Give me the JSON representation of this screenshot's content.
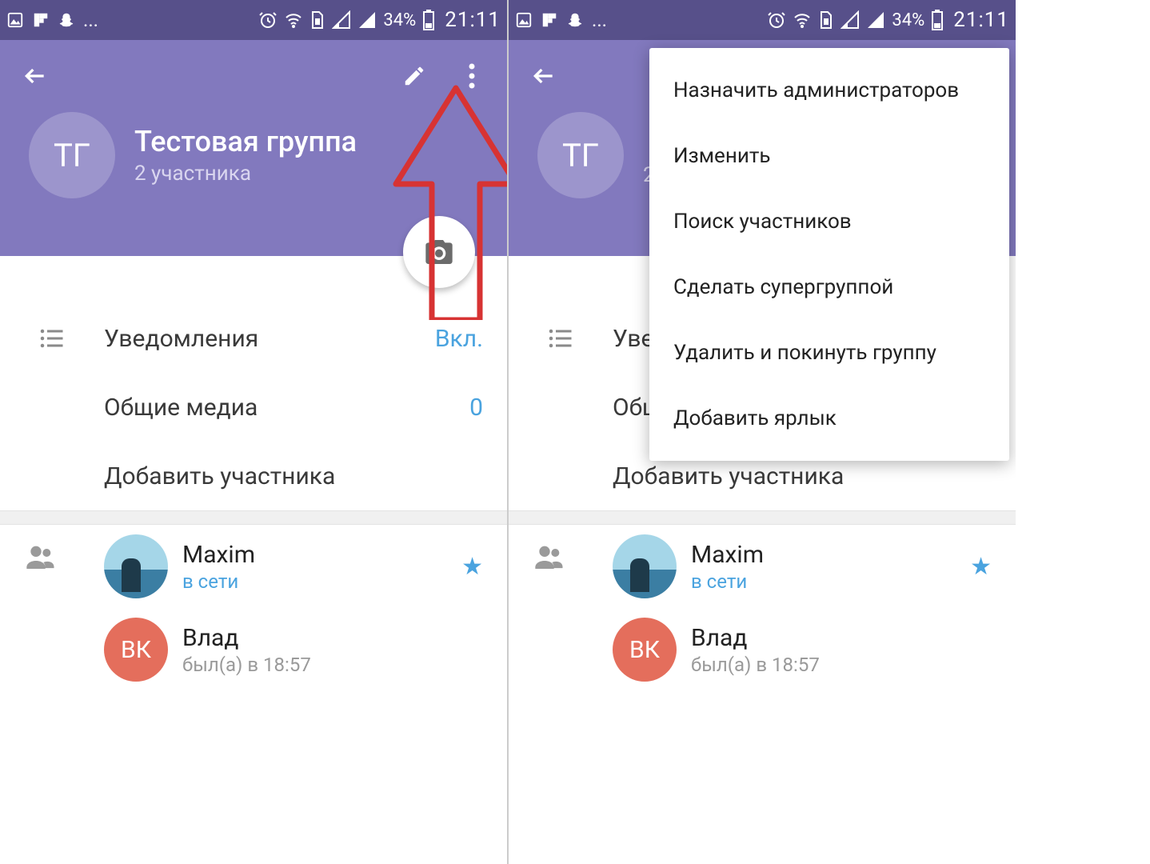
{
  "status": {
    "battery": "34%",
    "time": "21:11",
    "ellipsis": "..."
  },
  "header": {
    "avatar_initials": "ТГ",
    "title": "Тестовая группа",
    "subtitle": "2 участника"
  },
  "settings": {
    "notifications_label": "Уведомления",
    "notifications_value": "Вкл.",
    "shared_media_label": "Общие медиа",
    "shared_media_value": "0",
    "add_member_label": "Добавить участника"
  },
  "members": [
    {
      "name": "Maxim",
      "status": "в сети",
      "status_type": "online",
      "avatar_type": "photo",
      "initials": "",
      "starred": true
    },
    {
      "name": "Влад",
      "status": "был(а) в 18:57",
      "status_type": "offline",
      "avatar_type": "initials",
      "initials": "ВК",
      "starred": false
    }
  ],
  "menu": {
    "items": [
      "Назначить администраторов",
      "Изменить",
      "Поиск участников",
      "Сделать супергруппой",
      "Удалить и покинуть группу",
      "Добавить ярлык"
    ]
  },
  "colors": {
    "accent": "#8279be",
    "link": "#4aa3df"
  }
}
